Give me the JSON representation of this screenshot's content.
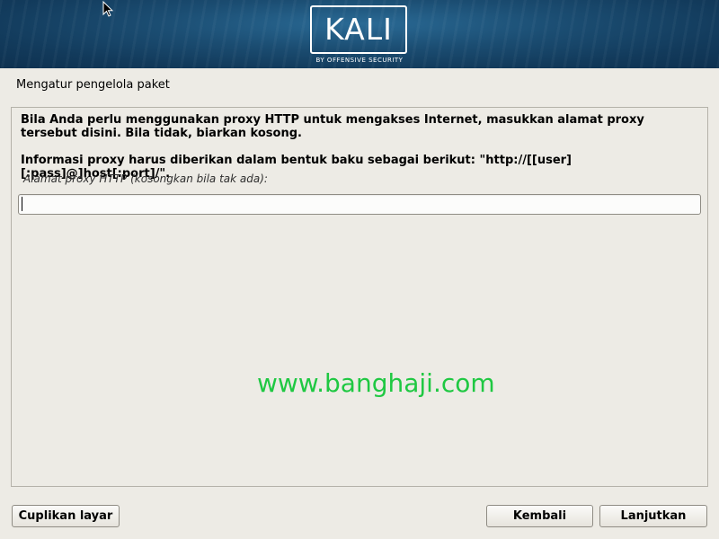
{
  "header": {
    "logo_text": "KALI",
    "logo_subtitle": "BY OFFENSIVE SECURITY"
  },
  "page": {
    "title": "Mengatur pengelola paket"
  },
  "content": {
    "description_1": "Bila Anda perlu menggunakan proxy HTTP untuk mengakses Internet, masukkan alamat proxy tersebut disini. Bila tidak, biarkan kosong.",
    "description_2": "Informasi proxy harus diberikan dalam bentuk baku sebagai berikut: \"http://[[user][:pass]@]host[:port]/\".",
    "field_label": "Alamat proxy HTTP (kosongkan bila tak ada):",
    "field_value": ""
  },
  "watermark": "www.banghaji.com",
  "buttons": {
    "screenshot": "Cuplikan layar",
    "back": "Kembali",
    "continue": "Lanjutkan"
  },
  "icons": {
    "cursor": "mouse-pointer-icon"
  },
  "colors": {
    "banner": "#1b4d72",
    "background": "#edebe5",
    "watermark": "#1fc842"
  }
}
